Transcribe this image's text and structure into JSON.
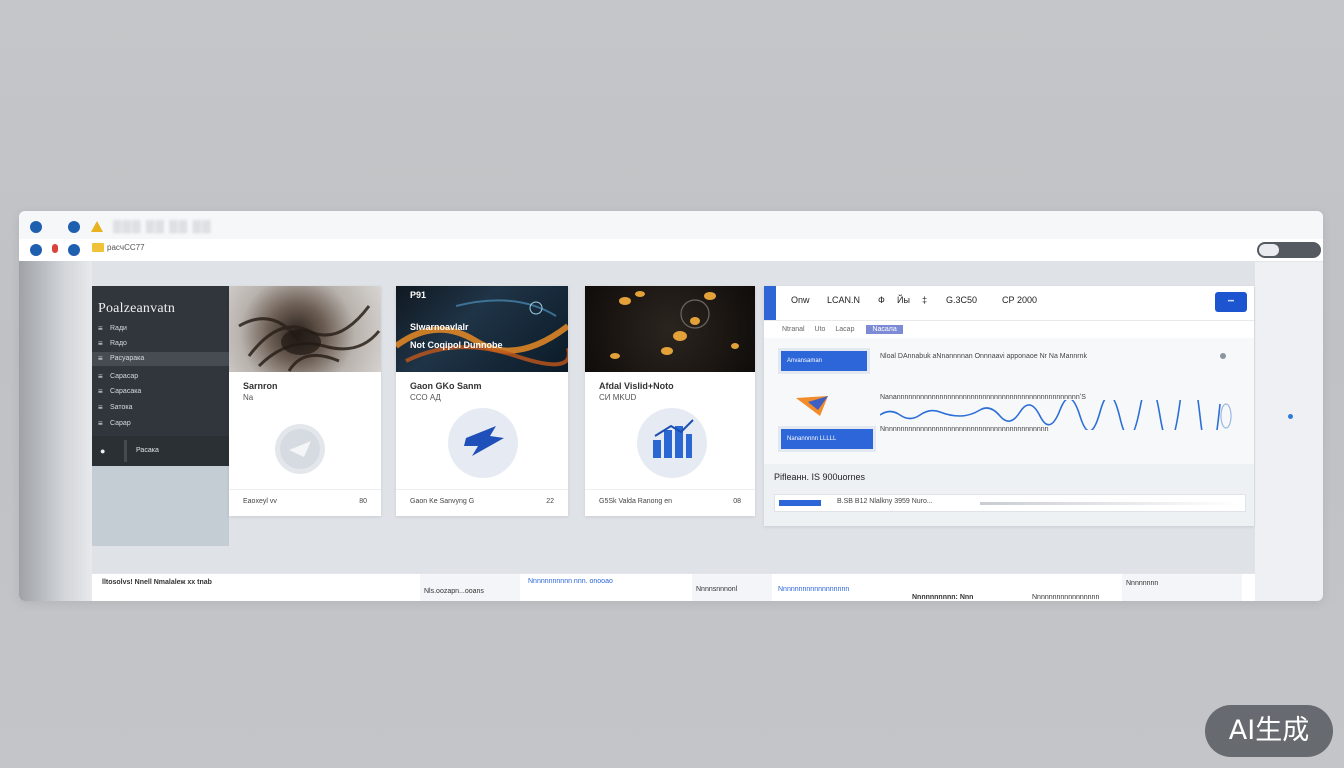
{
  "window": {
    "traffic_lights": [
      "#1f5fb0",
      "#1f5fb0",
      "#e8b21f"
    ],
    "blurred_title": "▒▒▒ ▒▒ ▒▒ ▒▒",
    "address_url": "pаcчСС77"
  },
  "sidebar": {
    "title": "Poalzeanvatn",
    "items": [
      {
        "icon": "≡",
        "label": "Rади"
      },
      {
        "icon": "≡",
        "label": "Rадо"
      },
      {
        "icon": "≡",
        "label": "Pасуарака"
      },
      {
        "icon": "≡",
        "label": "Сарасар"
      },
      {
        "icon": "≡",
        "label": "Сарасака"
      },
      {
        "icon": "≡",
        "label": "Sатока"
      },
      {
        "icon": "≡",
        "label": "Сарар"
      }
    ],
    "footer_label": "Расака"
  },
  "cards": [
    {
      "title": "Sarnron",
      "subtitle": "Na",
      "footer": "Eaoxeyl vv",
      "count": "80",
      "image_num": "",
      "image_text": ""
    },
    {
      "title": "Gaon GKo Sanm",
      "subtitle": "ССО АД",
      "footer": "Gaon Ke Sanvyng G",
      "count": "22",
      "image_num": "P91",
      "image_text": "Slwarnoavlalr\nNot Coqipol Dunnobe"
    },
    {
      "title": "Afdal Vislid+Noto",
      "subtitle": "СИ MKUD",
      "footer": "G5Sk Valda Ranong en",
      "count": "08",
      "image_num": "",
      "image_text": ""
    }
  ],
  "panel": {
    "tabs": [
      "Onw",
      "LCAN.N",
      "Ф",
      "Йы",
      "‡",
      "G.3C50",
      "СР 2000"
    ],
    "button": "•••",
    "subtabs": [
      "Ntranal",
      "Uto",
      "Lасар",
      "Nасала"
    ],
    "badge_top": "Anvansaman",
    "badge_bottom": "Nanannnnn LLLLL",
    "top_text": "Nloal DAnnabuk aNnannnnan Onnnaavi apponaoe Nr Na Mannrnk",
    "chart_label": "NanannnnnnnnnnnnnnnnnnnnnnnnnnnnnnnnnnnnnnnnnnnnnnnʻS",
    "sub_text": "Nnnnnnnnnnnnnnnnnnnnnnnnnnnnnnnnnnnnnnnnnnn",
    "stats_header": "Piflеанн. IS 900uornes",
    "stats_text": "B.SB B12 Nlalkny 3959 Nuro...",
    "accent_color": "#2e66d6"
  },
  "bottom": {
    "cells": [
      "lltosolvs! Nnell Nmalalеж хх tnab",
      "Nls.oozapn...ooans",
      "Nnnnnnnnnnn nnn. onooao",
      "Nnnnsnnnonl",
      "Nnnnnnnnnnnnnnnnnn",
      "Nnnnnnnnnn: Nnn",
      "Nnnnnnnnnnnnnnnnn",
      "Nnnnnnnn"
    ]
  },
  "watermark": "AI生成"
}
